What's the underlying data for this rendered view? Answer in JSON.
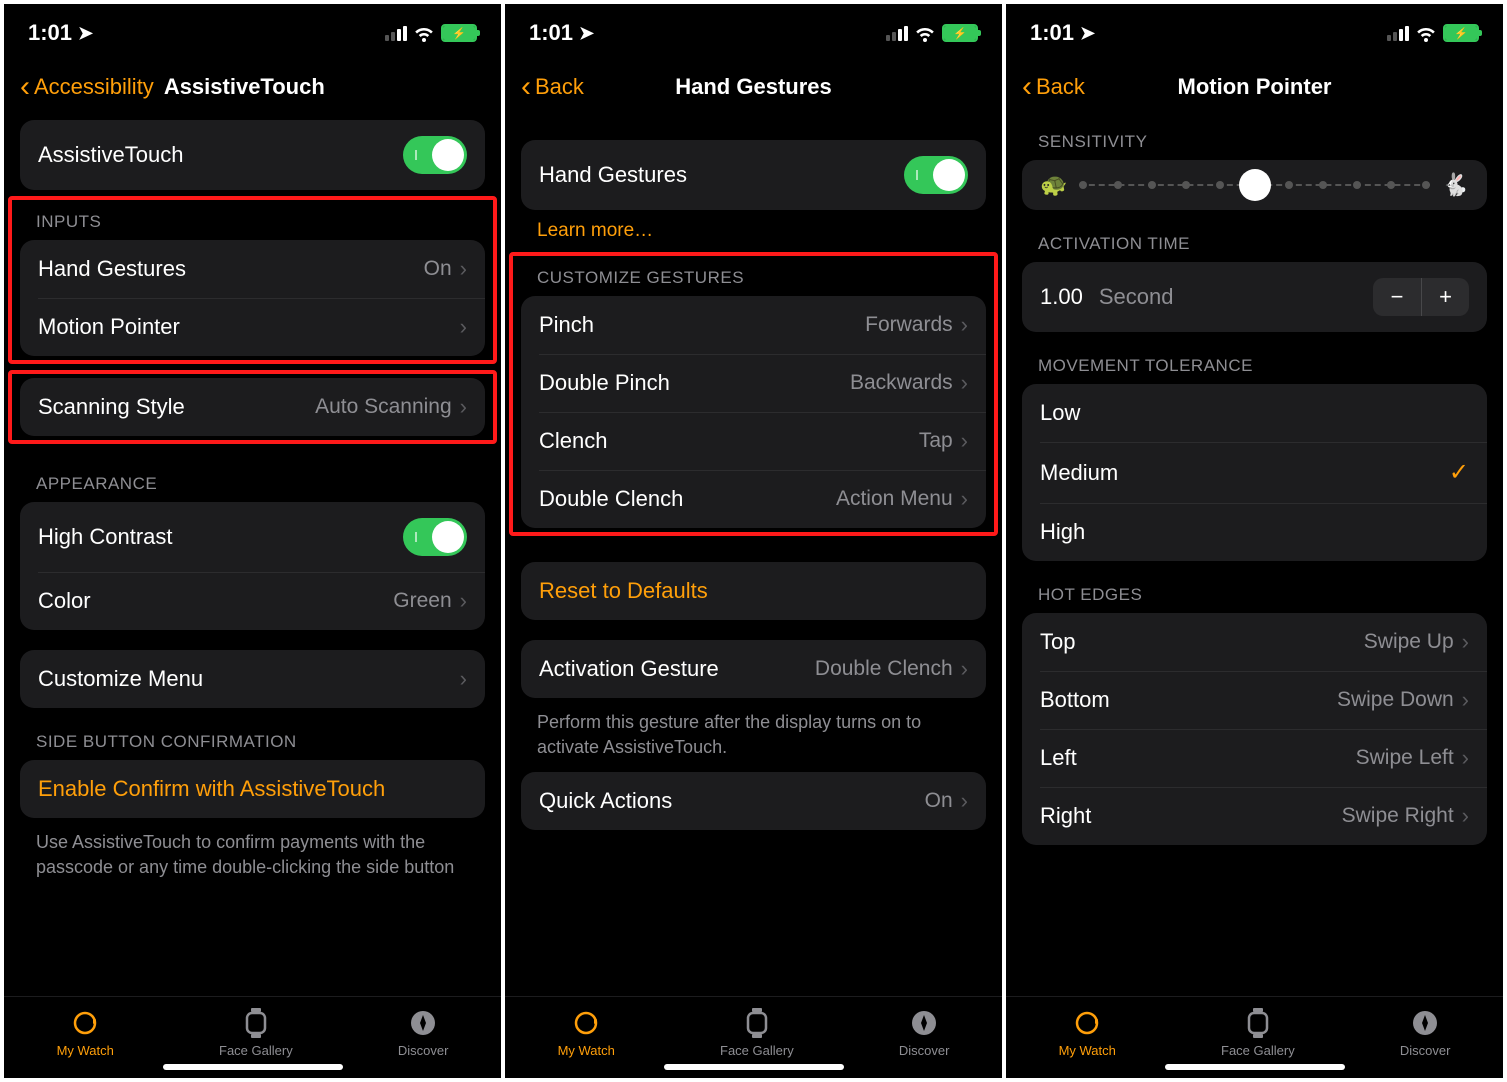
{
  "status": {
    "time": "1:01",
    "bolt": "⚡"
  },
  "tabs": {
    "watch": "My Watch",
    "gallery": "Face Gallery",
    "discover": "Discover"
  },
  "p1": {
    "back": "Accessibility",
    "title": "AssistiveTouch",
    "assistiveTouch": "AssistiveTouch",
    "inputsHeader": "INPUTS",
    "handGestures": "Hand Gestures",
    "handGesturesVal": "On",
    "motionPointer": "Motion Pointer",
    "scanningStyle": "Scanning Style",
    "scanningStyleVal": "Auto Scanning",
    "appearanceHeader": "APPEARANCE",
    "highContrast": "High Contrast",
    "color": "Color",
    "colorVal": "Green",
    "customizeMenu": "Customize Menu",
    "sideButtonHeader": "SIDE BUTTON CONFIRMATION",
    "enableConfirm": "Enable Confirm with AssistiveTouch",
    "footer": "Use AssistiveTouch to confirm payments with the passcode or any time double-clicking the side button"
  },
  "p2": {
    "back": "Back",
    "title": "Hand Gestures",
    "handGestures": "Hand Gestures",
    "learnMore": "Learn more…",
    "customizeHeader": "CUSTOMIZE GESTURES",
    "pinch": "Pinch",
    "pinchVal": "Forwards",
    "doublePinch": "Double Pinch",
    "doublePinchVal": "Backwards",
    "clench": "Clench",
    "clenchVal": "Tap",
    "doubleClench": "Double Clench",
    "doubleClenchVal": "Action Menu",
    "reset": "Reset to Defaults",
    "activationGesture": "Activation Gesture",
    "activationGestureVal": "Double Clench",
    "activationFooter": "Perform this gesture after the display turns on to activate AssistiveTouch.",
    "quickActions": "Quick Actions",
    "quickActionsVal": "On"
  },
  "p3": {
    "back": "Back",
    "title": "Motion Pointer",
    "sensitivityHeader": "SENSITIVITY",
    "activationTimeHeader": "ACTIVATION TIME",
    "timeVal": "1.00",
    "timeUnit": "Second",
    "minus": "−",
    "plus": "+",
    "toleranceHeader": "MOVEMENT TOLERANCE",
    "low": "Low",
    "medium": "Medium",
    "high": "High",
    "hotEdgesHeader": "HOT EDGES",
    "top": "Top",
    "topVal": "Swipe Up",
    "bottom": "Bottom",
    "bottomVal": "Swipe Down",
    "left": "Left",
    "leftVal": "Swipe Left",
    "right": "Right",
    "rightVal": "Swipe Right"
  }
}
